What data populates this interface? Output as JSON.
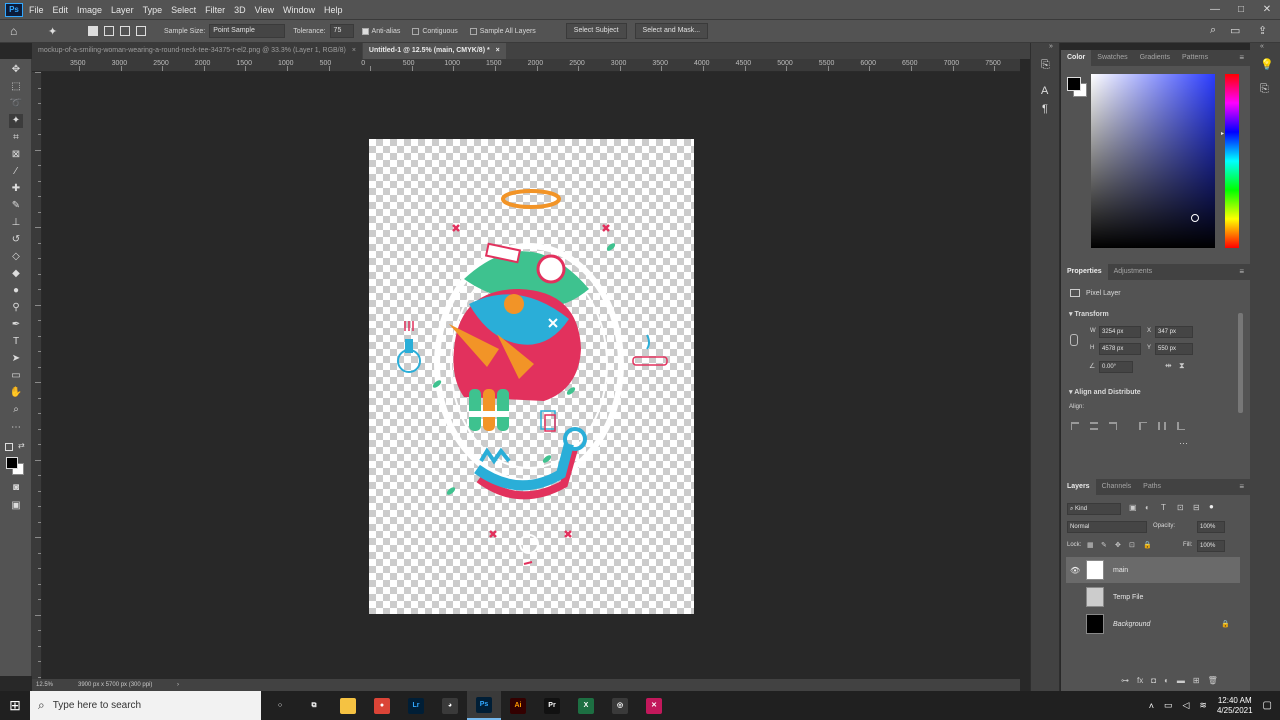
{
  "app": {
    "logo_text": "Ps"
  },
  "menu": [
    "File",
    "Edit",
    "Image",
    "Layer",
    "Type",
    "Select",
    "Filter",
    "3D",
    "View",
    "Window",
    "Help"
  ],
  "window_controls": {
    "minimize": "—",
    "maximize": "□",
    "close": "✕"
  },
  "options": {
    "sample_size_label": "Sample Size:",
    "sample_size_value": "Point Sample",
    "tolerance_label": "Tolerance:",
    "tolerance_value": "75",
    "anti_alias_label": "Anti-alias",
    "contiguous_label": "Contiguous",
    "sample_all_layers_label": "Sample All Layers",
    "select_subject_label": "Select Subject",
    "select_and_mask_label": "Select and Mask..."
  },
  "tabs": [
    {
      "label": "mockup-of-a-smiling-woman-wearing-a-round-neck-tee-34375-r-el2.png @ 33.3% (Layer 1, RGB/8)",
      "close": "×"
    },
    {
      "label": "Untitled-1 @ 12.5% (main, CMYK/8) *",
      "close": "×"
    }
  ],
  "ruler_h": [
    "3500",
    "3000",
    "2500",
    "2000",
    "1500",
    "1000",
    "500",
    "0",
    "500",
    "1000",
    "1500",
    "2000",
    "2500",
    "3000",
    "3500",
    "4000",
    "4500",
    "5000",
    "5500",
    "6000",
    "6500",
    "7000",
    "7500"
  ],
  "status": {
    "zoom": "12.5%",
    "doc_info": "3900 px x 5700 px (300 ppi)",
    "arrow": "›"
  },
  "color_panel": {
    "tabs": [
      "Color",
      "Swatches",
      "Gradients",
      "Patterns"
    ],
    "fg": "#000000",
    "bg": "#ffffff",
    "hue": "#2b3cff"
  },
  "properties": {
    "tabs": [
      "Properties",
      "Adjustments"
    ],
    "layer_type": "Pixel Layer",
    "transform_label": "Transform",
    "w_label": "W",
    "w": "3254 px",
    "h_label": "H",
    "h": "4578 px",
    "x_label": "X",
    "x": "347 px",
    "y_label": "Y",
    "y": "550 px",
    "angle": "0.00°",
    "align_title": "Align and Distribute",
    "align_label": "Align:"
  },
  "layers_panel": {
    "tabs": [
      "Layers",
      "Channels",
      "Paths"
    ],
    "kind": "Kind",
    "blend": "Normal",
    "opacity_label": "Opacity:",
    "opacity": "100%",
    "lock_label": "Lock:",
    "fill_label": "Fill:",
    "fill": "100%",
    "layers": [
      {
        "name": "main",
        "selected": true,
        "visible": true
      },
      {
        "name": "Temp File",
        "selected": false,
        "visible": false
      },
      {
        "name": "Background",
        "selected": false,
        "visible": false,
        "locked": true
      }
    ]
  },
  "taskbar": {
    "search_placeholder": "Type here to search",
    "apps": [
      {
        "name": "cortana-icon",
        "label": "○",
        "color": "#ffffff",
        "bg": "transparent"
      },
      {
        "name": "taskview-icon",
        "label": "⧉",
        "color": "#ffffff",
        "bg": "transparent"
      },
      {
        "name": "file-explorer-icon",
        "label": "",
        "color": "#333333",
        "bg": "#f5c242"
      },
      {
        "name": "chrome-icon",
        "label": "●",
        "color": "#ffffff",
        "bg": "#db4437"
      },
      {
        "name": "lightroom-icon",
        "label": "Lr",
        "color": "#31a8ff",
        "bg": "#001e36"
      },
      {
        "name": "app-icon",
        "label": "◕",
        "color": "#ffffff",
        "bg": "#3a3a3a"
      },
      {
        "name": "photoshop-icon",
        "label": "Ps",
        "color": "#31a8ff",
        "bg": "#001e36",
        "active": true
      },
      {
        "name": "illustrator-icon",
        "label": "Ai",
        "color": "#ff9a00",
        "bg": "#330000"
      },
      {
        "name": "printful-icon",
        "label": "Pr",
        "color": "#ffffff",
        "bg": "#111111"
      },
      {
        "name": "excel-icon",
        "label": "X",
        "color": "#ffffff",
        "bg": "#1d6f42"
      },
      {
        "name": "browser-icon",
        "label": "◎",
        "color": "#ffffff",
        "bg": "#3a3a3a"
      },
      {
        "name": "vector-app-icon",
        "label": "✕",
        "color": "#ffffff",
        "bg": "#c2185b"
      }
    ],
    "time": "12:40 AM",
    "date": "4/25/2021"
  }
}
